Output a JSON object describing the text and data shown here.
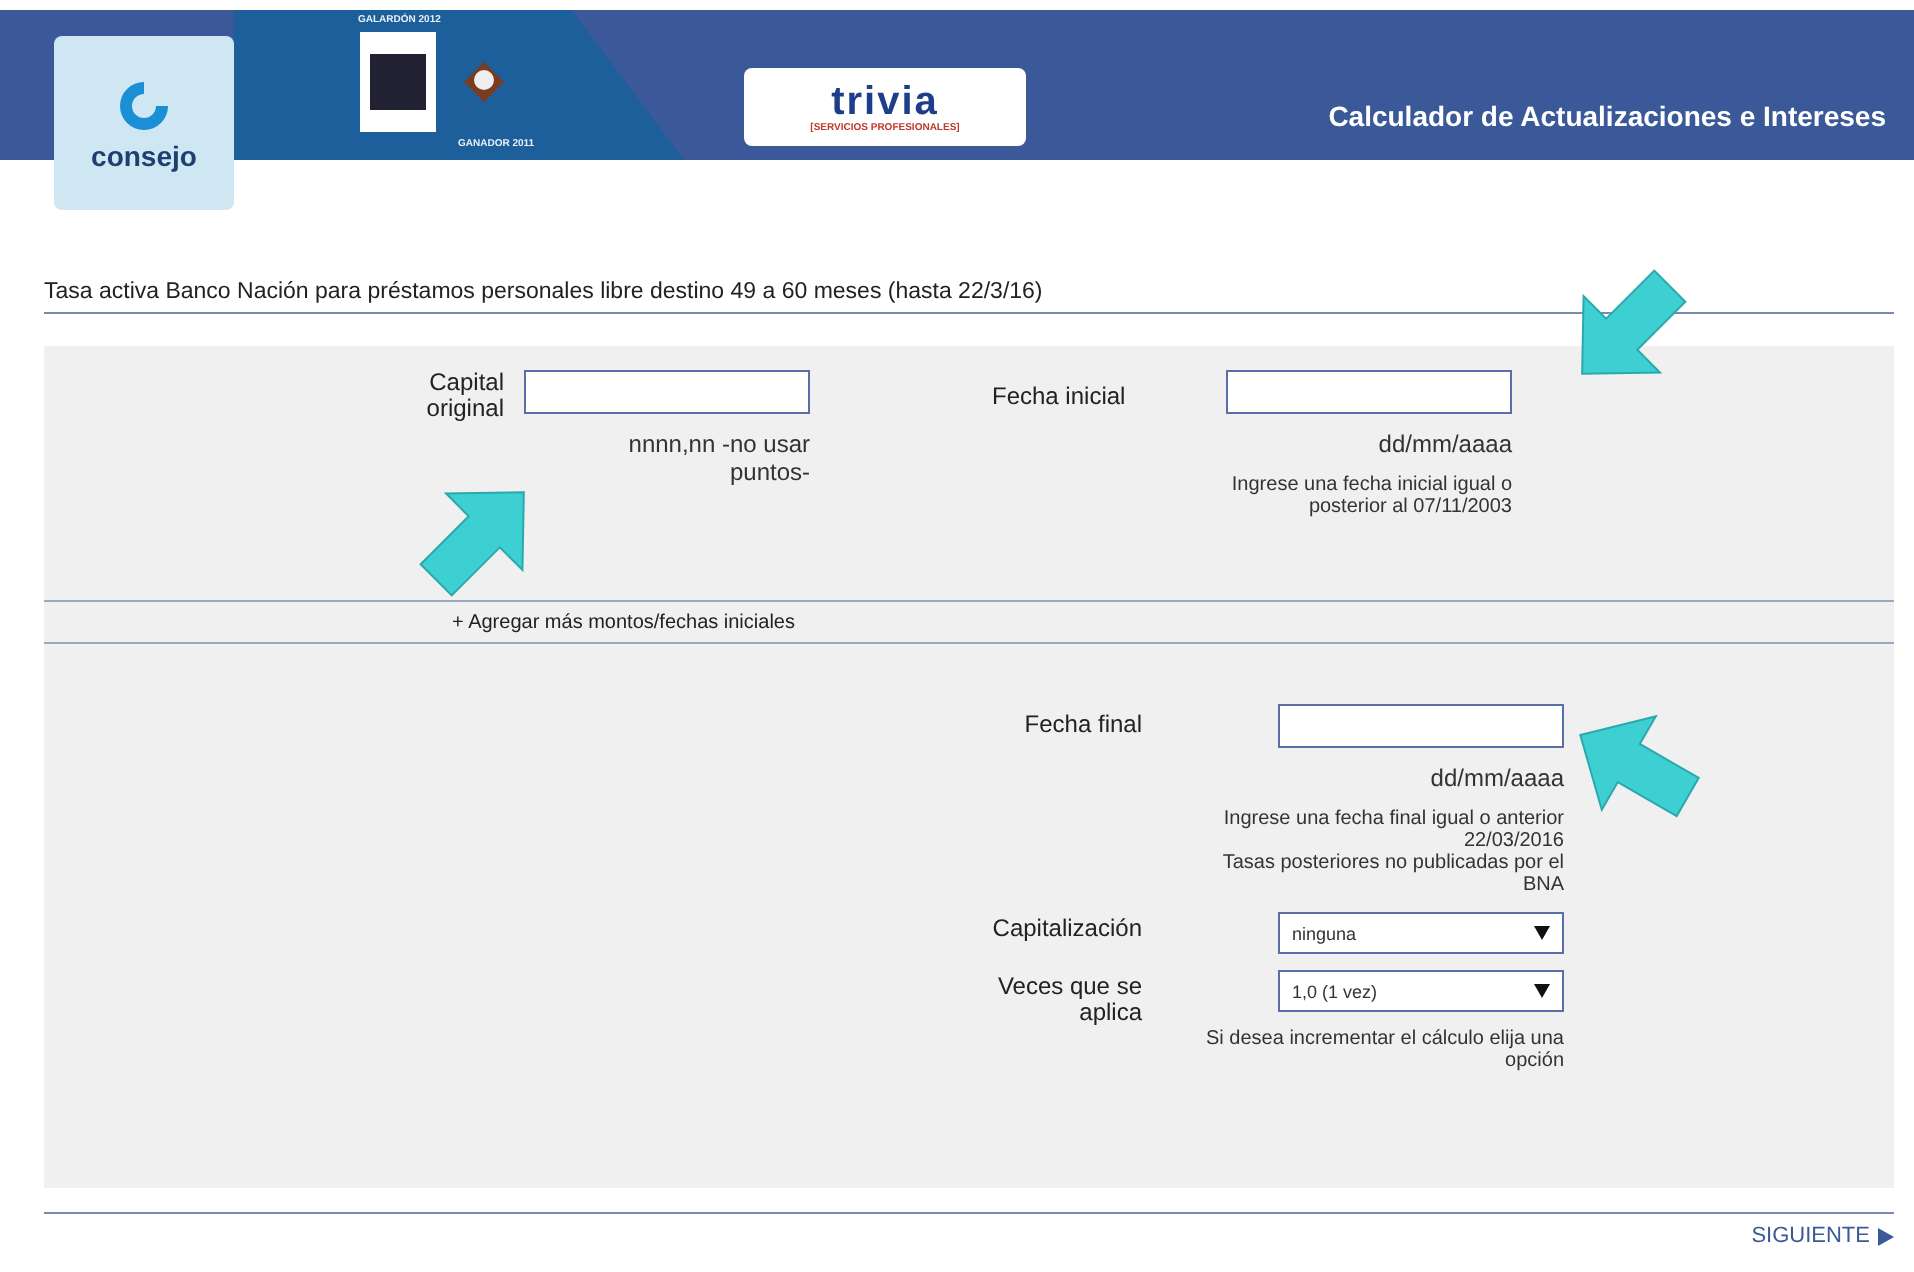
{
  "header": {
    "logo_text": "consejo",
    "award_top": "GALARDÓN 2012",
    "award_bottom": "GANADOR 2011",
    "brand": "trivia",
    "brand_tagline": "[SERVICIOS PROFESIONALES]",
    "title": "Calculador de Actualizaciones e Intereses"
  },
  "rate_description": "Tasa activa Banco Nación para préstamos personales libre destino 49 a 60 meses (hasta 22/3/16)",
  "initial_fields": [
    {
      "label": "Capital original",
      "hint": "nnnn,nn -no usar puntos-"
    },
    {
      "label": "Fecha inicial",
      "hint": "dd/mm/aaaa",
      "notes": [
        "Ingrese una fecha inicial igual o posterior al 07/11/2003"
      ]
    }
  ],
  "add_link": "+ Agregar más montos/fechas iniciales",
  "final_fields": [
    {
      "kind": "input",
      "label": "Fecha final",
      "hint": "dd/mm/aaaa",
      "notes": [
        "Ingrese una fecha final igual o anterior 22/03/2016",
        "Tasas posteriores no publicadas por el BNA"
      ]
    },
    {
      "kind": "select",
      "label": "Capitalización",
      "value": "ninguna"
    },
    {
      "kind": "select",
      "label": "Veces que se aplica",
      "value": "1,0 (1 vez)",
      "notes": [
        "Si desea incrementar el cálculo elija una opción"
      ]
    }
  ],
  "next_button": "SIGUIENTE"
}
